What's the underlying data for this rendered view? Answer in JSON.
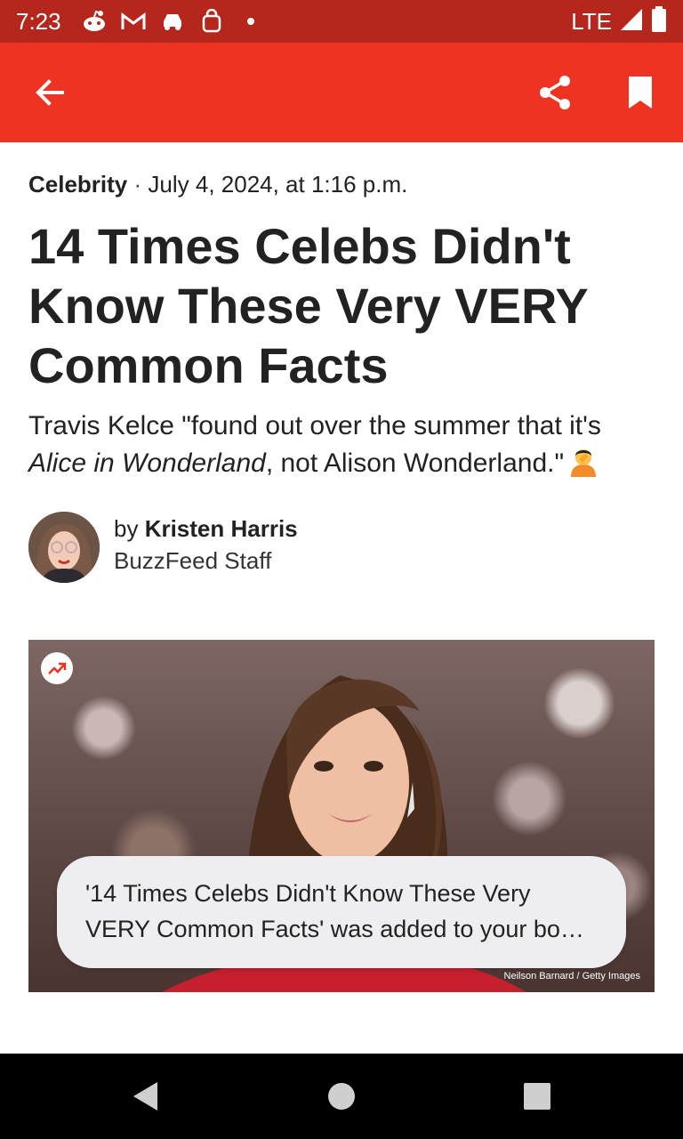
{
  "status_bar": {
    "time": "7:23",
    "network": "LTE"
  },
  "app_bar": {
    "back_icon": "arrow-left-icon",
    "share_icon": "share-icon",
    "bookmark_icon": "bookmark-icon",
    "background": "#ee3322"
  },
  "article": {
    "category": "Celebrity",
    "separator": "·",
    "date": "July 4, 2024, at 1:16 p.m.",
    "headline": "14 Times Celebs Didn't Know These Very VERY Common Facts",
    "dek_part1": "Travis Kelce \"found out over the summer that it's ",
    "dek_italic": "Alice in Wonderland",
    "dek_part2": ", not Alison Wonderland.\"",
    "byline_prefix": "by ",
    "author": "Kristen Harris",
    "author_role": "BuzzFeed Staff",
    "photo_credit": "Neilson Barnard / Getty Images"
  },
  "toast": {
    "message": "'14 Times Celebs Didn't Know These Very VERY Common Facts' was added to your bo…"
  }
}
